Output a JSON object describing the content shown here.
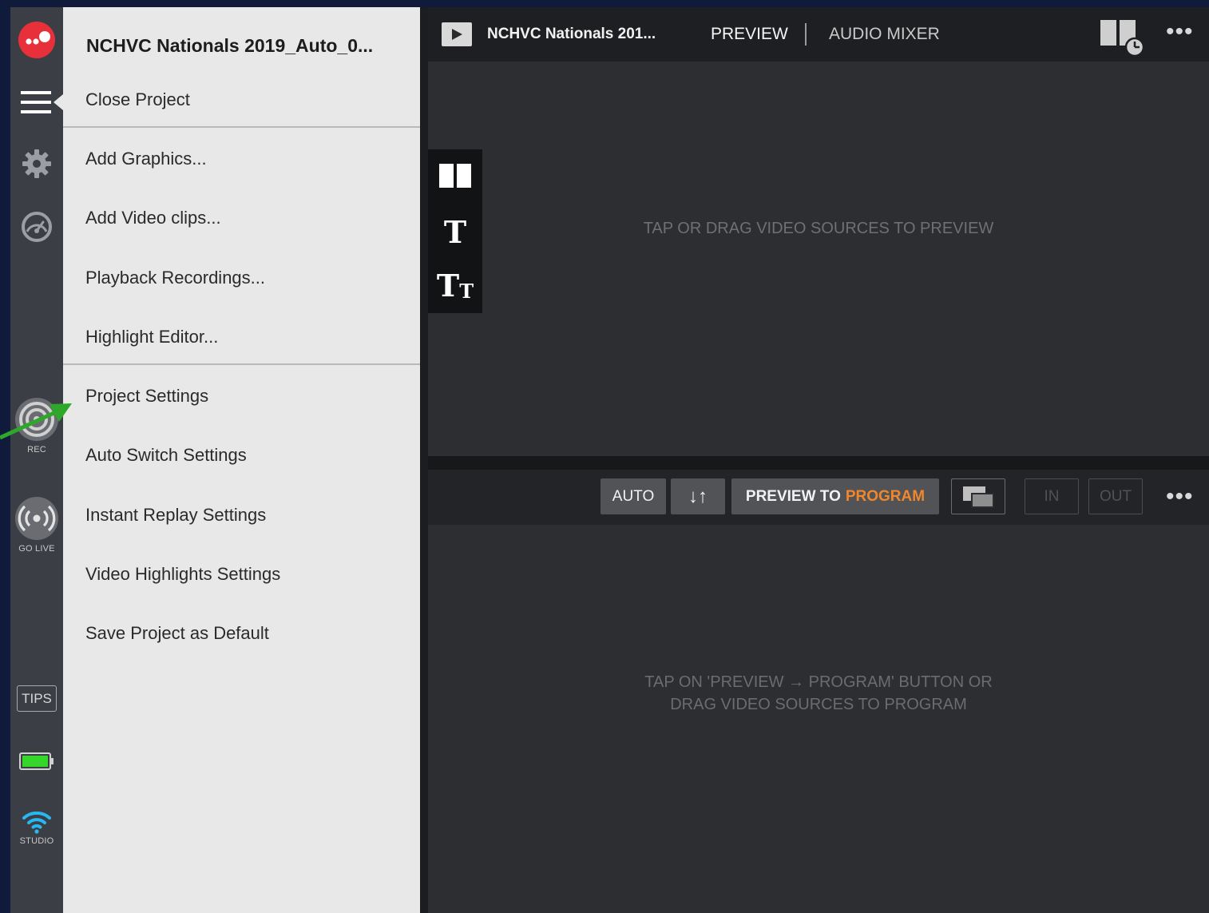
{
  "app": {
    "project_title_full": "NCHVC Nationals 2019_Auto_0...",
    "project_title_short": "NCHVC Nationals 201..."
  },
  "rail": {
    "rec_label": "REC",
    "golive_label": "GO LIVE",
    "tips_label": "TIPS",
    "studio_label": "STUDIO",
    "battery_level": 1.0,
    "icons": [
      "logo-icon",
      "menu-icon",
      "gear-icon",
      "gauge-icon",
      "record-icon",
      "broadcast-icon",
      "battery-icon",
      "wifi-icon"
    ]
  },
  "menu": {
    "items_group1": [
      {
        "label": "Close Project"
      }
    ],
    "items_group2": [
      {
        "label": "Add Graphics..."
      },
      {
        "label": "Add Video clips..."
      },
      {
        "label": "Playback Recordings..."
      },
      {
        "label": "Highlight Editor..."
      }
    ],
    "items_group3": [
      {
        "label": "Project Settings"
      },
      {
        "label": "Auto Switch Settings"
      },
      {
        "label": "Instant Replay Settings"
      },
      {
        "label": "Video Highlights Settings"
      },
      {
        "label": "Save Project as Default"
      }
    ]
  },
  "tabs": {
    "preview": "PREVIEW",
    "audio_mixer": "AUDIO MIXER"
  },
  "preview": {
    "hint": "TAP OR DRAG VIDEO SOURCES TO PREVIEW",
    "tools": [
      "layout-icon",
      "title-icon",
      "text-size-icon"
    ]
  },
  "controls": {
    "auto": "AUTO",
    "swap": "↓↑",
    "preview_word": "PREVIEW TO",
    "program_word": "PROGRAM",
    "in": "IN",
    "out": "OUT"
  },
  "program": {
    "hint_line1": "TAP ON 'PREVIEW → PROGRAM' BUTTON OR",
    "hint_line2": "DRAG VIDEO SOURCES TO PROGRAM"
  },
  "colors": {
    "accent_orange": "#f0872a",
    "brand_red": "#e8303a",
    "battery_green": "#35d62a",
    "wifi_blue": "#29b7f0",
    "annotation_green": "#2da82a"
  }
}
